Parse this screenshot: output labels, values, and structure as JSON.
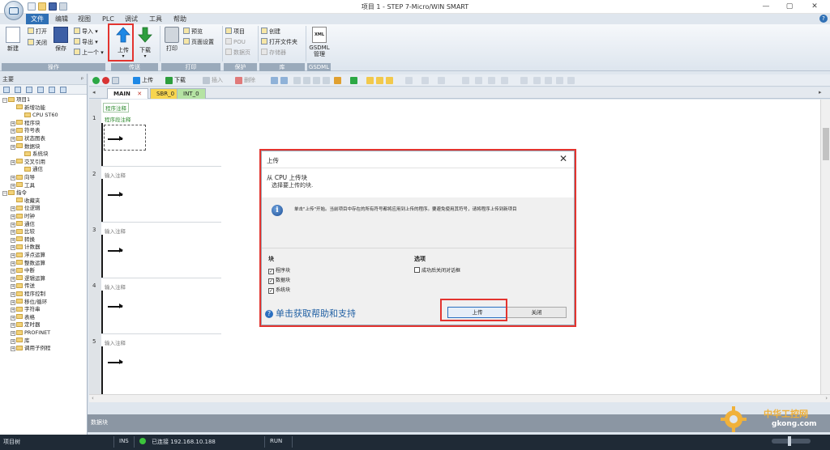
{
  "window": {
    "title": "项目 1 - STEP 7-Micro/WIN SMART",
    "controls": {
      "minimize": "—",
      "restore": "▢",
      "close": "✕",
      "help": "?"
    }
  },
  "menu": [
    "文件",
    "编辑",
    "视图",
    "PLC",
    "调试",
    "工具",
    "帮助"
  ],
  "ribbon": {
    "new_label": "新建",
    "open_label": "打开",
    "close_label": "关闭",
    "save_label": "保存",
    "import_label": "导入",
    "export_label": "导出",
    "previous_label": "上一个",
    "upload_label": "上传",
    "download_label": "下载",
    "print_label": "打印",
    "preview_label": "预览",
    "page_setup_label": "页面设置",
    "project_label": "项目",
    "pou_label": "POU",
    "datapage_label": "数据页",
    "create_label": "创建",
    "open_folder_label": "打开文件夹",
    "memory_card_label": "存储器",
    "gsdml_label": "GSDML 管理",
    "gsdml_icon_text": "XML",
    "groups": [
      "操作",
      "传送",
      "打印",
      "保护",
      "库",
      "GSDML"
    ]
  },
  "left_panel": {
    "title": "主要",
    "pin": "ᵖ",
    "tree": [
      {
        "label": "项目1",
        "indent": 0,
        "exp": "−"
      },
      {
        "label": "新增功能",
        "indent": 1,
        "exp": ""
      },
      {
        "label": "CPU ST60",
        "indent": 2,
        "exp": ""
      },
      {
        "label": "程序块",
        "indent": 1,
        "exp": "+"
      },
      {
        "label": "符号表",
        "indent": 1,
        "exp": "+"
      },
      {
        "label": "状态图表",
        "indent": 1,
        "exp": "+"
      },
      {
        "label": "数据块",
        "indent": 1,
        "exp": "+"
      },
      {
        "label": "系统块",
        "indent": 2,
        "exp": ""
      },
      {
        "label": "交叉引用",
        "indent": 1,
        "exp": "+"
      },
      {
        "label": "通信",
        "indent": 2,
        "exp": ""
      },
      {
        "label": "向导",
        "indent": 1,
        "exp": "+"
      },
      {
        "label": "工具",
        "indent": 1,
        "exp": "+"
      },
      {
        "label": "指令",
        "indent": 0,
        "exp": "−"
      },
      {
        "label": "收藏夹",
        "indent": 1,
        "exp": ""
      },
      {
        "label": "位逻辑",
        "indent": 1,
        "exp": "+"
      },
      {
        "label": "时钟",
        "indent": 1,
        "exp": "+"
      },
      {
        "label": "通信",
        "indent": 1,
        "exp": "+"
      },
      {
        "label": "比较",
        "indent": 1,
        "exp": "+"
      },
      {
        "label": "转换",
        "indent": 1,
        "exp": "+"
      },
      {
        "label": "计数器",
        "indent": 1,
        "exp": "+"
      },
      {
        "label": "浮点运算",
        "indent": 1,
        "exp": "+"
      },
      {
        "label": "整数运算",
        "indent": 1,
        "exp": "+"
      },
      {
        "label": "中断",
        "indent": 1,
        "exp": "+"
      },
      {
        "label": "逻辑运算",
        "indent": 1,
        "exp": "+"
      },
      {
        "label": "传送",
        "indent": 1,
        "exp": "+"
      },
      {
        "label": "程序控制",
        "indent": 1,
        "exp": "+"
      },
      {
        "label": "移位/循环",
        "indent": 1,
        "exp": "+"
      },
      {
        "label": "字符串",
        "indent": 1,
        "exp": "+"
      },
      {
        "label": "表格",
        "indent": 1,
        "exp": "+"
      },
      {
        "label": "定时器",
        "indent": 1,
        "exp": "+"
      },
      {
        "label": "PROFINET",
        "indent": 1,
        "exp": "+"
      },
      {
        "label": "库",
        "indent": 1,
        "exp": "+"
      },
      {
        "label": "调用子例程",
        "indent": 1,
        "exp": "+"
      }
    ]
  },
  "editor_toolbar": {
    "upload_label": "上传",
    "download_label": "下载",
    "insert_label": "插入",
    "delete_label": "删除"
  },
  "tabs": [
    "MAIN",
    "SBR_0",
    "INT_0"
  ],
  "tab_close": "✕",
  "editor": {
    "block_comment": "程序注释",
    "networks": [
      {
        "number": "1",
        "comment": "程序段注释"
      },
      {
        "number": "2",
        "comment": "输入注释"
      },
      {
        "number": "3",
        "comment": "输入注释"
      },
      {
        "number": "4",
        "comment": "输入注释"
      },
      {
        "number": "5",
        "comment": "输入注释"
      }
    ]
  },
  "output": {
    "title": "数据块"
  },
  "status_bar": {
    "project_tree": "项目树",
    "ins": "INS",
    "connection": "已连接 192.168.10.188",
    "mode": "RUN"
  },
  "dialog": {
    "title": "上传",
    "close": "✕",
    "heading": "从 CPU 上传块",
    "subheading": "选择要上传的块.",
    "info_icon_text": "i",
    "info_text": "单击\"上传\"开始。当前项目中存在的所有符号都将应用到上传的程序。要避免使用其符号，请将程序上传到新项目",
    "blocks_section": "块",
    "blocks": [
      {
        "label": "程序块",
        "checked": "✓"
      },
      {
        "label": "数据块",
        "checked": "✓"
      },
      {
        "label": "系统块",
        "checked": "✓"
      }
    ],
    "options_section": "选项",
    "option_label": "成功后关闭对话框",
    "help_icon_text": "?",
    "help_link": "单击获取帮助和支持",
    "upload_button": "上传",
    "close_button": "关闭"
  },
  "watermark": {
    "text1": "中华工控网",
    "text2": "gkong.com"
  },
  "colors": {
    "accent": "#2f70b5",
    "highlight": "#e3342f",
    "upload_arrow": "#1e88e5",
    "download_arrow": "#2e9e3e"
  }
}
